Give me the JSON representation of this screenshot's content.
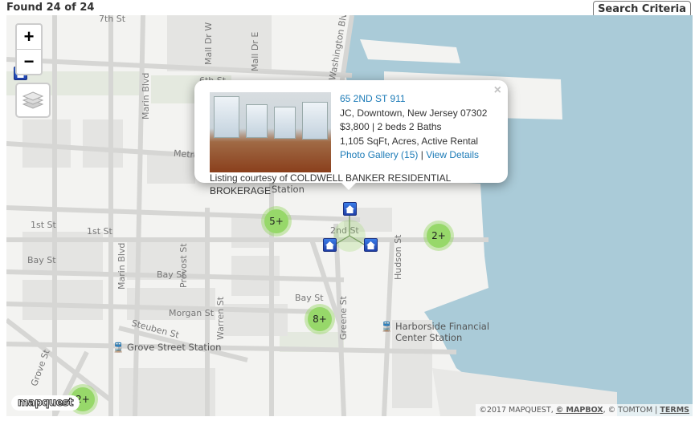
{
  "header": {
    "found_text": "Found 24 of 24",
    "search_criteria_label": "Search Criteria"
  },
  "map": {
    "zoom_in_label": "+",
    "zoom_out_label": "−",
    "layers_icon": "layers-icon",
    "colors": {
      "water": "#aacbd8",
      "land": "#f3f3f1",
      "cluster": "#97d86a",
      "link": "#1c7bb7"
    },
    "street_labels": {
      "seventh_st": "7th St",
      "sixth_st": "6th St",
      "mall_dr_w": "Mall Dr W",
      "mall_dr_e": "Mall Dr E",
      "washington_blvd": "Washington Blvd",
      "marin_blvd_top": "Marin Blvd",
      "marin_blvd_bottom": "Marin Blvd",
      "metro": "Metro",
      "first_st_left": "1st St",
      "first_st_mid": "1st St",
      "bay_st_left": "Bay St",
      "bay_st_mid": "Bay St",
      "bay_st_right": "Bay St",
      "provost_st": "Provost St",
      "morgan_st": "Morgan St",
      "steuben_st": "Steuben St",
      "warren_st": "Warren St",
      "grove_st": "Grove St",
      "greene_st": "Greene St",
      "hudson_st": "Hudson St",
      "second_st": "2nd St",
      "station": "Station"
    },
    "pois": [
      {
        "name": "Grove Street Station",
        "icon": "train-icon"
      },
      {
        "name": "Harborside Financial Center Station",
        "line1": "Harborside Financial",
        "line2": "Center Station",
        "icon": "train-icon"
      }
    ],
    "clusters": [
      {
        "label": "5+"
      },
      {
        "label": "2+"
      },
      {
        "label": "8+"
      },
      {
        "label": "2+"
      }
    ],
    "house_markers": 4,
    "popup": {
      "address": "65 2ND ST 911",
      "location": "JC, Downtown, New Jersey 07302",
      "price_line": "$3,800 | 2 beds 2 Baths",
      "details_line": "1,105 SqFt, Acres, Active Rental",
      "photo_gallery_label": "Photo Gallery (15)",
      "separator": " | ",
      "view_details_label": "View Details",
      "courtesy": "Listing courtesy of COLDWELL BANKER RESIDENTIAL BROKERAGE",
      "close_label": "×"
    },
    "logo_text": "mapquest",
    "attribution": {
      "prefix": "©2017 MAPQUEST, ",
      "mapbox": "© MAPBOX",
      "middle": ", © TOMTOM | ",
      "terms": "TERMS"
    }
  }
}
